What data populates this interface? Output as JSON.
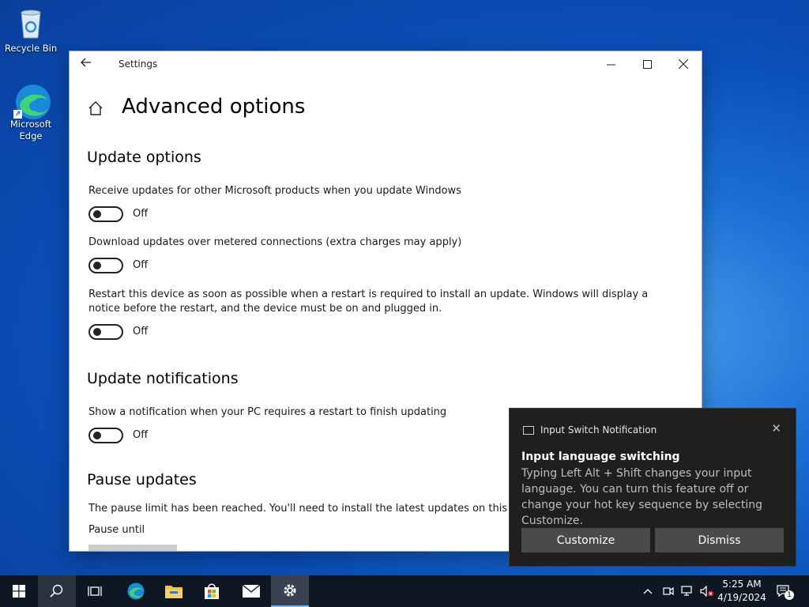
{
  "desktop": {
    "icons": [
      {
        "label": "Recycle Bin"
      },
      {
        "label": "Microsoft Edge"
      }
    ]
  },
  "window": {
    "title": "Settings",
    "page_title": "Advanced options",
    "sections": {
      "update_options": "Update options",
      "update_notifications": "Update notifications",
      "pause_updates": "Pause updates"
    },
    "options": [
      {
        "label": "Receive updates for other Microsoft products when you update Windows",
        "state": "Off"
      },
      {
        "label": "Download updates over metered connections (extra charges may apply)",
        "state": "Off"
      },
      {
        "label": "Restart this device as soon as possible when a restart is required to install an update. Windows will display a notice before the restart, and the device must be on and plugged in.",
        "state": "Off"
      },
      {
        "label": "Show a notification when your PC requires a restart to finish updating",
        "state": "Off"
      }
    ],
    "pause_text": "The pause limit has been reached. You'll need to install the latest updates on this devic",
    "pause_until": "Pause until"
  },
  "toast": {
    "app_name": "Input Switch Notification",
    "title": "Input language switching",
    "body": "Typing Left Alt + Shift changes your input language. You can turn this feature off or change your hot key sequence by selecting Customize.",
    "customize_label": "Customize",
    "dismiss_label": "Dismiss"
  },
  "taskbar": {
    "time": "5:25 AM",
    "date": "4/19/2024",
    "notification_count": "1"
  },
  "colors": {
    "accent": "#0078d7",
    "toast_bg": "#1f1f1f",
    "taskbar_bg": "#0f1722"
  }
}
